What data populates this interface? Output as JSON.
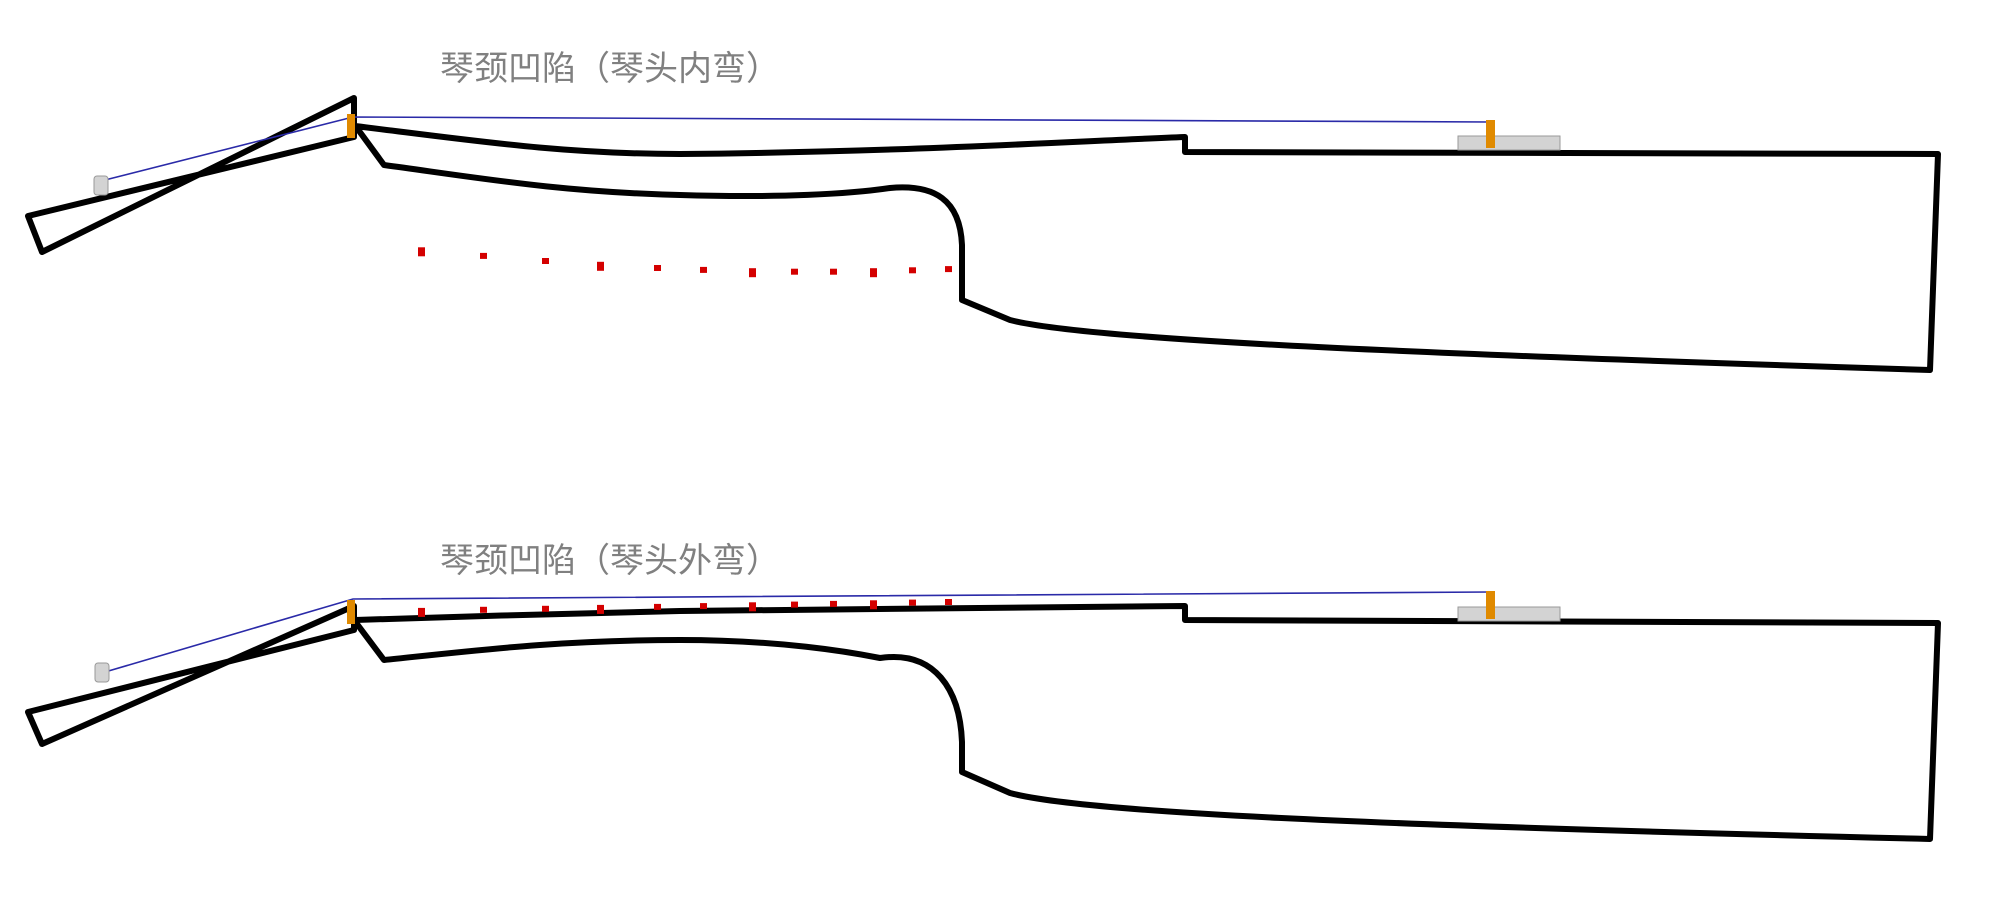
{
  "colors": {
    "background": "#ffffff",
    "outline": "#000000",
    "title_text": "#808080",
    "string": "#2a2aa8",
    "nut_and_saddle": "#e08a00",
    "frets": "#d40000",
    "bridge_and_tuner": "#d3d3d3",
    "bridge_and_tuner_border": "#999999"
  },
  "diagrams": [
    {
      "title": "琴颈凹陷（琴头内弯）",
      "fret_count": 12
    },
    {
      "title": "琴颈凹陷（琴头外弯）",
      "fret_count": 12
    }
  ]
}
